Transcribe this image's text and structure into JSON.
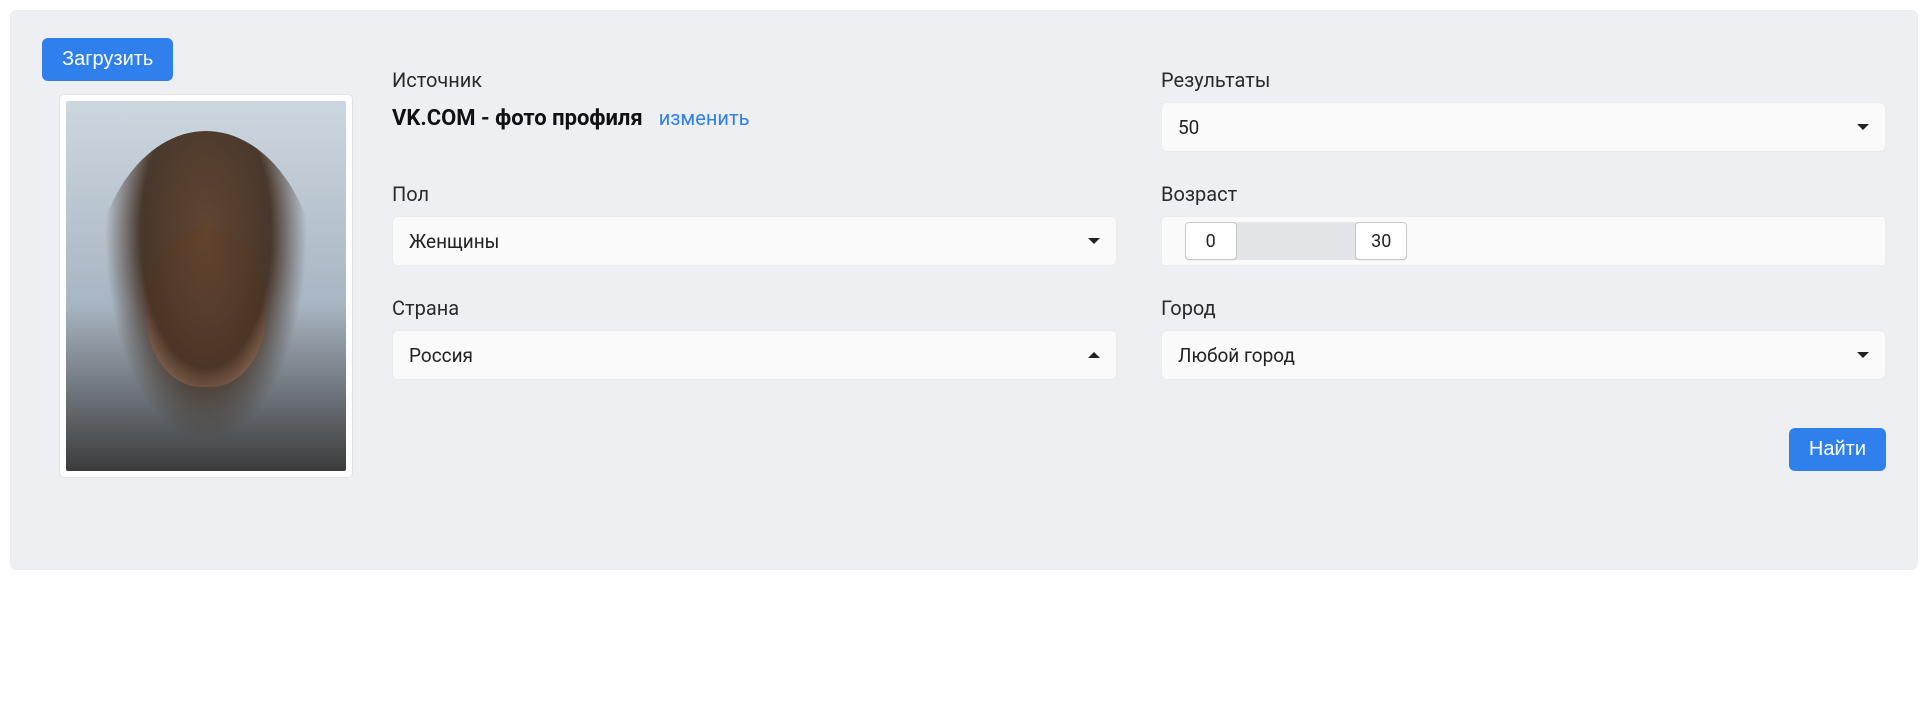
{
  "upload_label": "Загрузить",
  "source": {
    "label": "Источник",
    "value": "VK.COM - фото профиля",
    "change_label": "изменить"
  },
  "results": {
    "label": "Результаты",
    "value": "50"
  },
  "gender": {
    "label": "Пол",
    "value": "Женщины"
  },
  "age": {
    "label": "Возраст",
    "min": "0",
    "max": "30",
    "range_min": 0,
    "range_max": 100
  },
  "country": {
    "label": "Страна",
    "value": "Россия"
  },
  "city": {
    "label": "Город",
    "value": "Любой город"
  },
  "search_label": "Найти"
}
